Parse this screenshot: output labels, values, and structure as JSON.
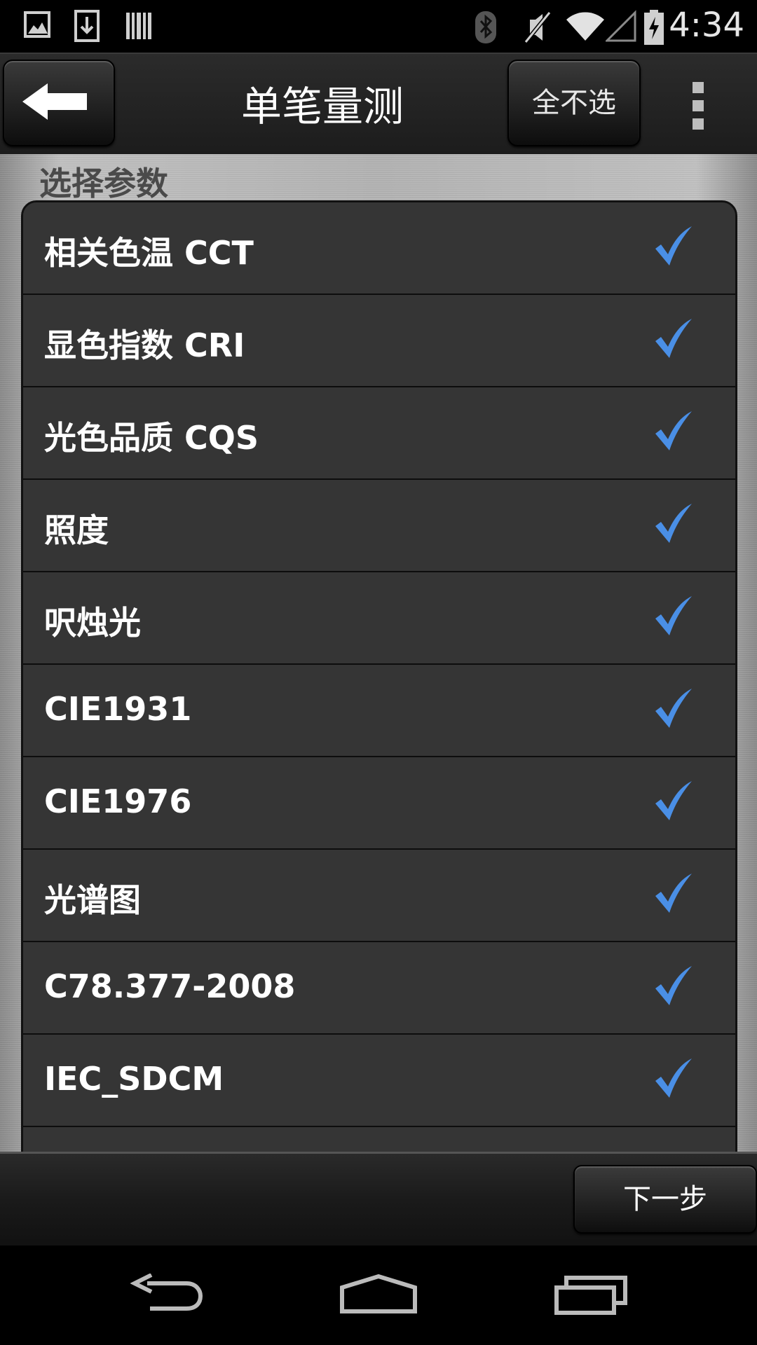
{
  "status_bar": {
    "time": "4:34",
    "icons": [
      "image-icon",
      "download-icon",
      "barcode-icon",
      "bluetooth-icon",
      "mute-icon",
      "wifi-icon",
      "signal-icon",
      "battery-charging-icon"
    ]
  },
  "action_bar": {
    "title": "单笔量测",
    "deselect_all_label": "全不选"
  },
  "section": {
    "title": "选择参数"
  },
  "parameters": [
    {
      "label": "相关色温 CCT",
      "checked": true
    },
    {
      "label": "显色指数 CRI",
      "checked": true
    },
    {
      "label": "光色品质 CQS",
      "checked": true
    },
    {
      "label": "照度",
      "checked": true
    },
    {
      "label": "呎烛光",
      "checked": true
    },
    {
      "label": "CIE1931",
      "checked": true
    },
    {
      "label": "CIE1976",
      "checked": true
    },
    {
      "label": "光谱图",
      "checked": true
    },
    {
      "label": "C78.377-2008",
      "checked": true
    },
    {
      "label": "IEC_SDCM",
      "checked": true
    }
  ],
  "bottom_bar": {
    "next_label": "下一步"
  },
  "colors": {
    "check": "#4a8fe6",
    "list_bg": "#353535",
    "action_bar_bg": "#222222"
  }
}
